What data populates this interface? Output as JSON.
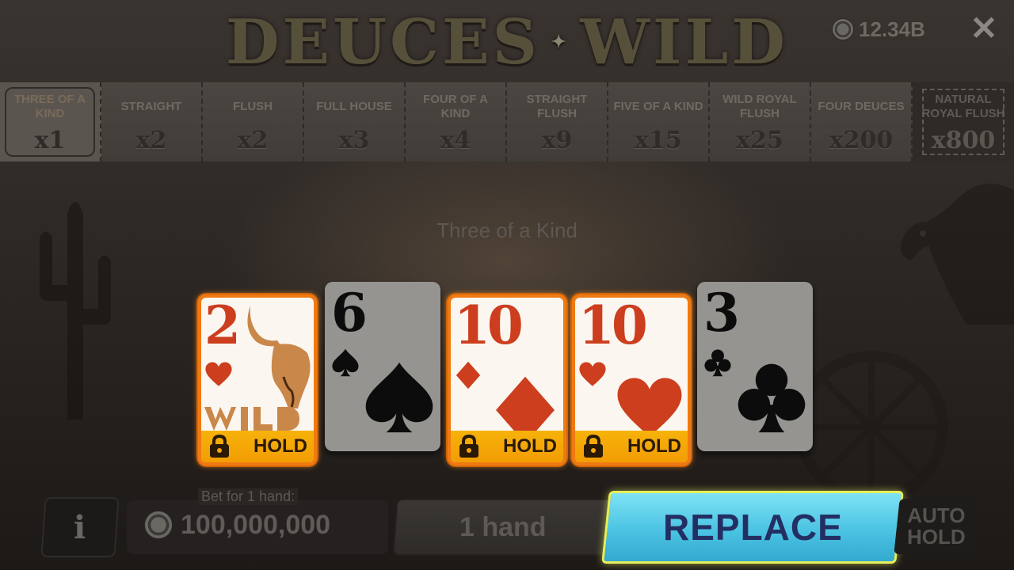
{
  "header": {
    "title_left": "DEUCES",
    "title_right": "WILD",
    "balance": "12.34B",
    "close_icon": "close-icon"
  },
  "paytable": [
    {
      "name": "THREE OF A KIND",
      "mult": "x1",
      "state": "active"
    },
    {
      "name": "STRAIGHT",
      "mult": "x2"
    },
    {
      "name": "FLUSH",
      "mult": "x2"
    },
    {
      "name": "FULL HOUSE",
      "mult": "x3"
    },
    {
      "name": "FOUR OF A KIND",
      "mult": "x4"
    },
    {
      "name": "STRAIGHT FLUSH",
      "mult": "x9"
    },
    {
      "name": "FIVE OF A KIND",
      "mult": "x15"
    },
    {
      "name": "WILD ROYAL FLUSH",
      "mult": "x25"
    },
    {
      "name": "FOUR DEUCES",
      "mult": "x200"
    },
    {
      "name": "NATURAL ROYAL FLUSH",
      "mult": "x800",
      "state": "natural"
    }
  ],
  "result_text": "Three of a Kind",
  "cards": [
    {
      "rank": "2",
      "suit": "hearts",
      "held": true,
      "wild": true
    },
    {
      "rank": "6",
      "suit": "spades",
      "held": false
    },
    {
      "rank": "10",
      "suit": "diamonds",
      "held": true
    },
    {
      "rank": "10",
      "suit": "hearts",
      "held": true
    },
    {
      "rank": "3",
      "suit": "clubs",
      "held": false
    }
  ],
  "hold_label": "HOLD",
  "bottom": {
    "info_label": "i",
    "bet_label": "Bet for 1 hand:",
    "bet_value": "100,000,000",
    "hands_label": "1 hand",
    "replace_label": "REPLACE",
    "autohold_label": "AUTO\nHOLD"
  },
  "colors": {
    "hold_border": "#f07a12",
    "hold_bar": "#f6b20a",
    "replace_bg": "#4bc3e3",
    "replace_border": "#e7ef5a",
    "red_suit": "#cc3e1e"
  }
}
